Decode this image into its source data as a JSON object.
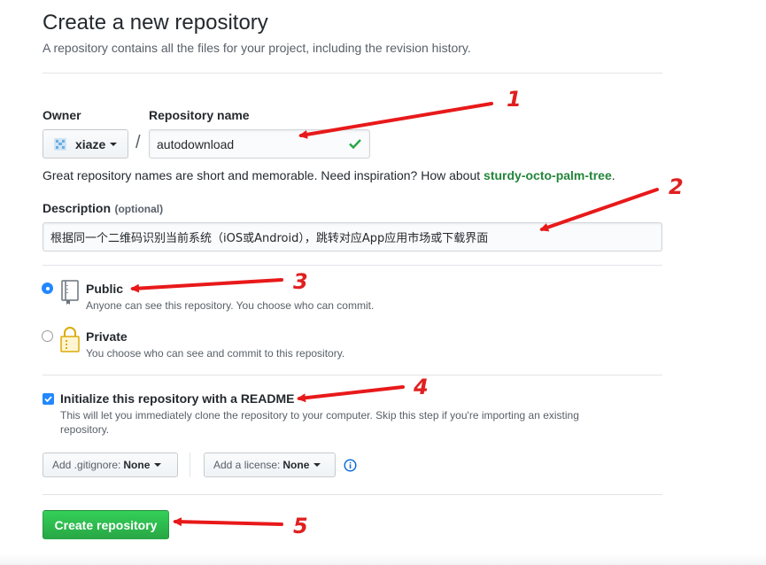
{
  "header": {
    "title": "Create a new repository",
    "subtitle": "A repository contains all the files for your project, including the revision history."
  },
  "owner": {
    "label": "Owner",
    "value": "xiaze"
  },
  "separator": "/",
  "repo_name": {
    "label": "Repository name",
    "value": "autodownload"
  },
  "hint": {
    "prefix": "Great repository names are short and memorable. Need inspiration? How about ",
    "suggestion": "sturdy-octo-palm-tree",
    "suffix": "."
  },
  "description": {
    "label": "Description",
    "optional": "(optional)",
    "value": "根据同一个二维码识别当前系统（iOS或Android），跳转对应App应用市场或下载界面"
  },
  "visibility": {
    "public": {
      "label": "Public",
      "note": "Anyone can see this repository. You choose who can commit.",
      "checked": true
    },
    "private": {
      "label": "Private",
      "note": "You choose who can see and commit to this repository.",
      "checked": false
    }
  },
  "readme": {
    "label": "Initialize this repository with a README",
    "note_line1": "This will let you immediately clone the repository to your computer. Skip this step if you're importing an existing",
    "note_line2": "repository.",
    "checked": true
  },
  "gitignore": {
    "prefix": "Add .gitignore: ",
    "value": "None"
  },
  "license": {
    "prefix": "Add a license: ",
    "value": "None"
  },
  "info_icon": "info-icon",
  "create_button": "Create repository",
  "annotations": [
    "1",
    "2",
    "3",
    "4",
    "5"
  ],
  "colors": {
    "primary": "#28a745",
    "link_green": "#22863a",
    "accent_blue": "#0366d6",
    "annotation_red": "#e02020"
  }
}
